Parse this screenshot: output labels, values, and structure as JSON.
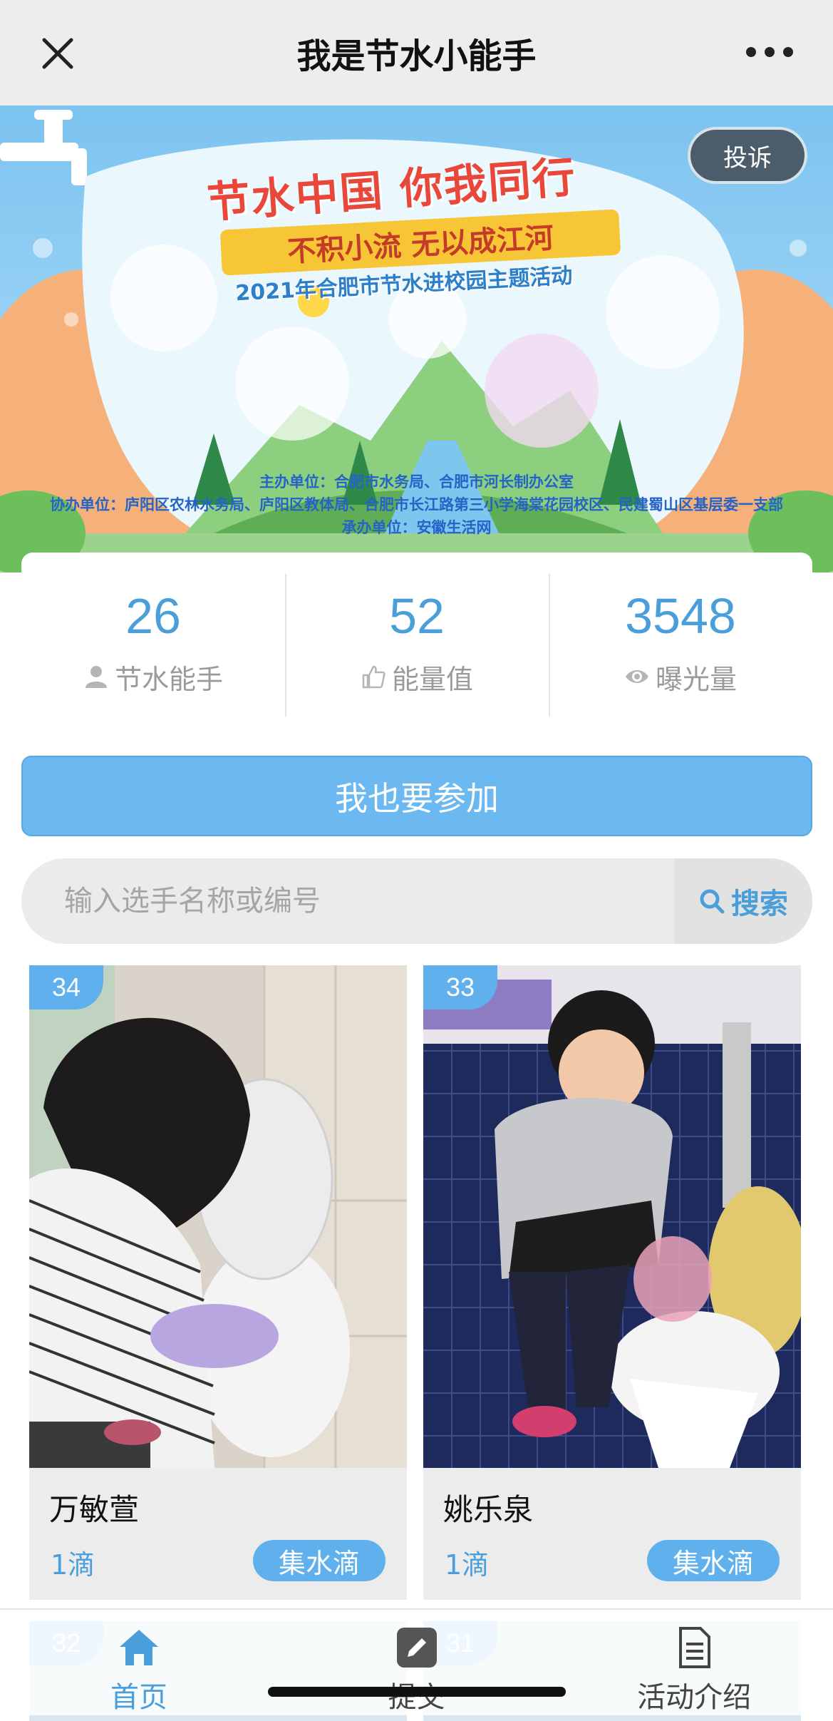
{
  "navbar": {
    "title": "我是节水小能手"
  },
  "banner": {
    "complain_label": "投诉",
    "title": "节水中国 你我同行",
    "subtitle": "不积小流 无以成江河",
    "event": "2021年合肥市节水进校园主题活动",
    "host": "主办单位：合肥市水务局、合肥市河长制办公室",
    "co_host": "协办单位：庐阳区农林水务局、庐阳区教体局、合肥市长江路第三小学海棠花园校区、民建蜀山区基层委一支部",
    "organizer": "承办单位：安徽生活网"
  },
  "stats": [
    {
      "value": "26",
      "label": "节水能手",
      "icon": "user-icon"
    },
    {
      "value": "52",
      "label": "能量值",
      "icon": "thumbs-up-icon"
    },
    {
      "value": "3548",
      "label": "曝光量",
      "icon": "eye-icon"
    }
  ],
  "join_label": "我也要参加",
  "search": {
    "placeholder": "输入选手名称或编号",
    "button_label": "搜索"
  },
  "cards": [
    {
      "number": "34",
      "name": "万敏萱",
      "drops": "1滴",
      "action": "集水滴"
    },
    {
      "number": "33",
      "name": "姚乐泉",
      "drops": "1滴",
      "action": "集水滴"
    }
  ],
  "peek_cards": [
    {
      "number": "32"
    },
    {
      "number": "31"
    }
  ],
  "tabs": [
    {
      "label": "首页",
      "icon": "home-icon",
      "active": true
    },
    {
      "label": "提交",
      "icon": "edit-icon",
      "active": false
    },
    {
      "label": "活动介绍",
      "icon": "document-icon",
      "active": false
    }
  ],
  "colors": {
    "accent": "#5fb0ec",
    "number": "#4a9fdb",
    "navbar_bg": "#ededed"
  }
}
